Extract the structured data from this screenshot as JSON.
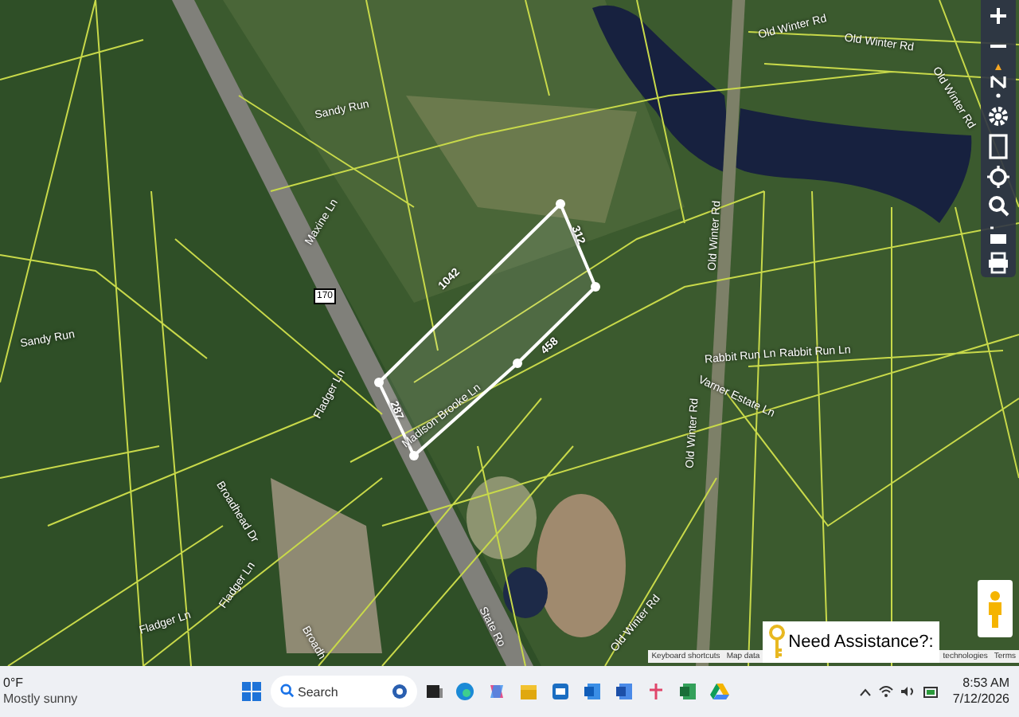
{
  "map": {
    "labels": [
      {
        "kind": "road",
        "text": "Sandy Run"
      },
      {
        "kind": "road",
        "text": "Maxine Ln"
      },
      {
        "kind": "road",
        "text": "Sandy Run"
      },
      {
        "kind": "road",
        "text": "Fladger Ln"
      },
      {
        "kind": "road",
        "text": "Madison Brooke Ln"
      },
      {
        "kind": "road",
        "text": "Broadhead Dr"
      },
      {
        "kind": "road",
        "text": "Fladger Ln"
      },
      {
        "kind": "road",
        "text": "Fladger Ln"
      },
      {
        "kind": "road",
        "text": "Broadh"
      },
      {
        "kind": "road",
        "text": "State Ro"
      },
      {
        "kind": "road",
        "text": "Old Winter Rd"
      },
      {
        "kind": "road",
        "text": "Old Winter Rd"
      },
      {
        "kind": "road",
        "text": "Old Winter Rd"
      },
      {
        "kind": "road",
        "text": "Old Winter Rd"
      },
      {
        "kind": "road",
        "text": "Old Winter Rd"
      },
      {
        "kind": "road",
        "text": "Old Winter Rd"
      },
      {
        "kind": "road",
        "text": "Rabbit Run Ln"
      },
      {
        "kind": "road",
        "text": "Rabbit Run Ln"
      },
      {
        "kind": "road",
        "text": "Varner Estate Ln"
      },
      {
        "kind": "shield",
        "text": "170"
      },
      {
        "kind": "measurement",
        "text": "1042"
      },
      {
        "kind": "measurement",
        "text": "312"
      },
      {
        "kind": "measurement",
        "text": "458"
      },
      {
        "kind": "measurement",
        "text": "287"
      }
    ],
    "attribution": [
      "Keyboard shortcuts",
      "Map data",
      "technologies",
      "Terms"
    ],
    "assistance": {
      "label": "Need Assistance?:"
    }
  },
  "taskbar": {
    "weather": {
      "temperature": "0°F",
      "condition": "Mostly sunny"
    },
    "search": {
      "placeholder": "Search"
    },
    "time": "8:53 AM",
    "date": "7/12/2026"
  }
}
